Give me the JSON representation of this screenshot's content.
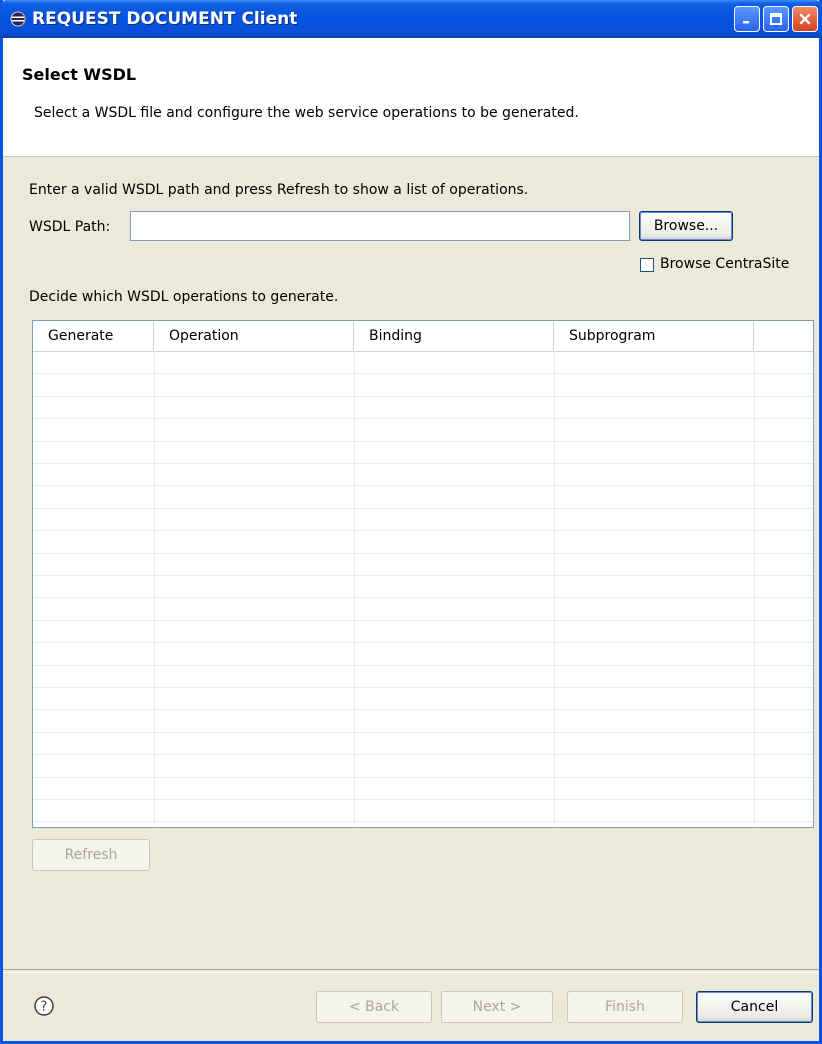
{
  "window": {
    "title": "REQUEST DOCUMENT Client"
  },
  "header": {
    "title": "Select WSDL",
    "description": "Select a WSDL file and configure the web service operations to be generated."
  },
  "form": {
    "instruction": "Enter a valid WSDL path and press Refresh to show a list of operations.",
    "wsdl_path_label": "WSDL Path:",
    "wsdl_path_value": "",
    "browse_button": "Browse...",
    "browse_centrasite_label": "Browse CentraSite",
    "browse_centrasite_checked": false,
    "operations_label": "Decide which WSDL operations to generate."
  },
  "table": {
    "columns": [
      "Generate",
      "Operation",
      "Binding",
      "Subprogram"
    ],
    "rows": []
  },
  "refresh_button": "Refresh",
  "footer": {
    "back_button": "< Back",
    "next_button": "Next >",
    "finish_button": "Finish",
    "cancel_button": "Cancel"
  }
}
